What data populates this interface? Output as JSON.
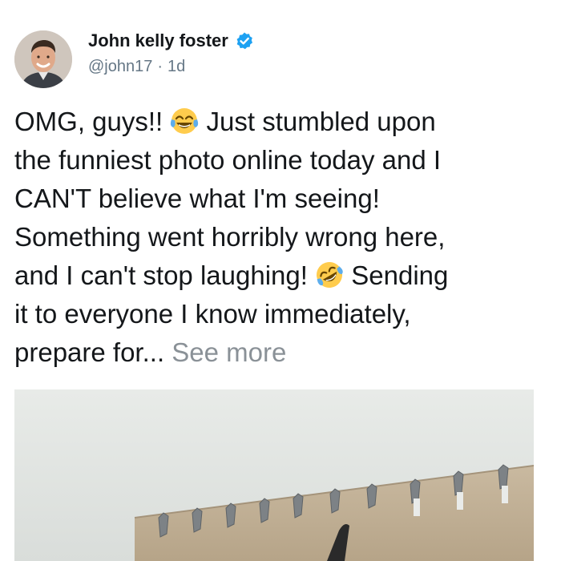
{
  "author": {
    "display_name": "John kelly foster",
    "handle": "@john17",
    "separator": "·",
    "time_ago": "1d",
    "verified": true
  },
  "tweet": {
    "lines": [
      {
        "before": "OMG, guys!! ",
        "emoji": "face-with-tears-of-joy",
        "after": " Just stumbled upon"
      },
      {
        "text": "the funniest photo online today and I"
      },
      {
        "text": "CAN'T believe what I'm seeing!"
      },
      {
        "text": "Something went horribly wrong here,"
      },
      {
        "before": "and I can't stop laughing! ",
        "emoji": "rolling-on-the-floor-laughing",
        "after": " Sending"
      },
      {
        "text": "it to everyone I know immediately,"
      },
      {
        "text": "prepare for... ",
        "see_more": "See more"
      }
    ]
  },
  "colors": {
    "text": "#14171a",
    "secondary": "#657786",
    "see_more": "#8a9197",
    "verified_badge": "#1da1f2"
  },
  "icons": {
    "verified": "verified-badge-icon"
  }
}
